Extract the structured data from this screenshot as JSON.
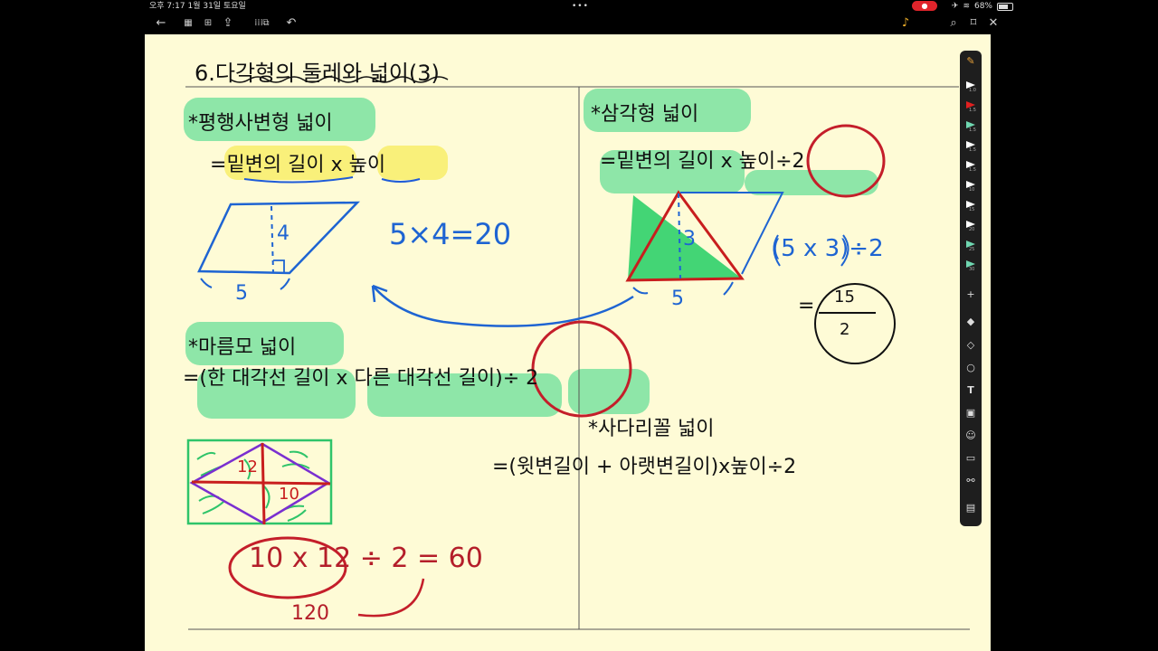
{
  "status_bar": {
    "time_date": "오후 7:17   1월 31일 토요일",
    "dots": "•••",
    "battery": "68%",
    "record_label": "●"
  },
  "toolbar_icons": [
    "back-arrow-icon",
    "grid-icon",
    "pages-icon",
    "export-icon",
    "apps-icon",
    "screen-icon",
    "undo-icon",
    "mic-icon",
    "search-icon",
    "bookmark-icon",
    "close-icon"
  ],
  "note": {
    "title": "6.다각형의 둘레와 넓이(3)",
    "parallelogram": {
      "heading": "*평행사변형 넓이",
      "formula_eq": "=",
      "formula_base": "밑변의 길이",
      "formula_times": " x ",
      "formula_height": "높이",
      "side_height": "4",
      "side_base": "5",
      "calc": "5×4=20"
    },
    "triangle": {
      "heading": "*삼각형 넓이",
      "formula": "=밑변의 길이 x 높이÷2",
      "side_height": "3",
      "side_base": "5",
      "calc": "(5 x 3)÷2",
      "result_eq": "=",
      "result_num": "15",
      "result_den": "2"
    },
    "rhombus": {
      "heading": "*마름모 넓이",
      "formula": "=(한 대각선 길이 x 다른 대각선 길이)÷ 2",
      "diag1": "12",
      "diag2": "10",
      "calc": "10 x 12 ÷ 2 = 60",
      "sub": "120"
    },
    "trapezoid": {
      "heading": "*사다리꼴 넓이",
      "formula": "=(윗변길이 + 아랫변길이)x높이÷2"
    }
  },
  "palette": {
    "pen_sizes": [
      "1.0",
      "1.5",
      "1.5",
      "1.5",
      "1.5",
      "10",
      "15",
      "20",
      "25",
      "30"
    ],
    "pen_colors": [
      "#ffffff",
      "#ffffff",
      "#e02020",
      "#6fd6b0",
      "#ffffff",
      "#ffffff",
      "#ffffff",
      "#ffffff",
      "#ffffff",
      "#6fd6b0",
      "#6fd6b0"
    ],
    "tools": [
      "plus-icon",
      "eraser-icon",
      "shapes-icon",
      "lasso-icon",
      "text-icon",
      "image-icon",
      "sticker-icon",
      "comment-icon",
      "link-icon",
      "page-icon"
    ]
  }
}
